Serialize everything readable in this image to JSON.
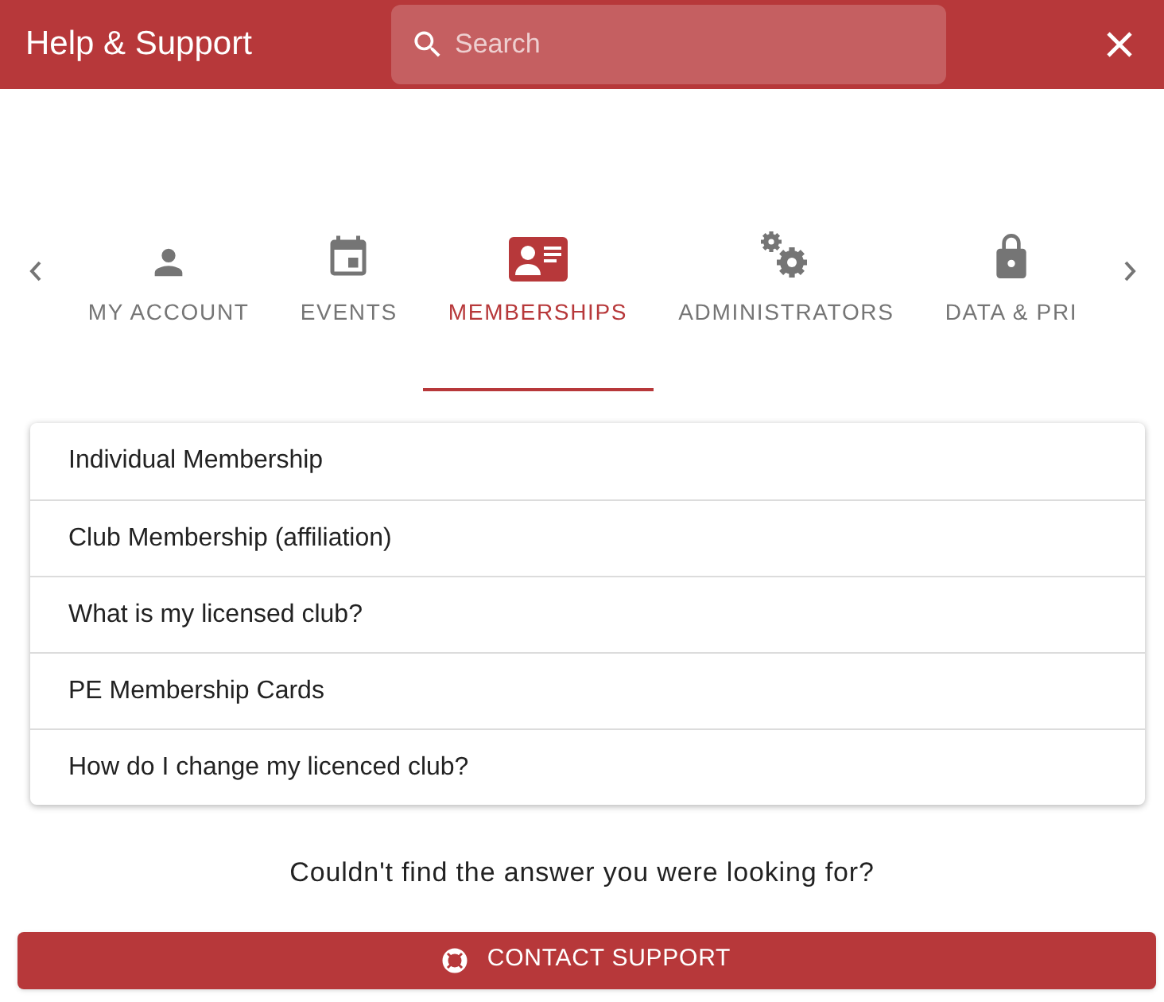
{
  "header": {
    "title": "Help & Support",
    "search": {
      "placeholder": "Search"
    }
  },
  "tabs": [
    {
      "label": "MY ACCOUNT",
      "kind": "person",
      "selected": false
    },
    {
      "label": "EVENTS",
      "kind": "calendar",
      "selected": false
    },
    {
      "label": "MEMBERSHIPS",
      "kind": "card",
      "selected": true
    },
    {
      "label": "ADMINISTRATORS",
      "kind": "gears",
      "selected": false
    },
    {
      "label": "DATA & PRI",
      "kind": "lock",
      "selected": false
    }
  ],
  "topics": [
    "Individual Membership",
    "Club Membership (affiliation)",
    "What is my licensed club?",
    "PE Membership Cards",
    "How do I change my licenced club?"
  ],
  "prompt": "Couldn't find the answer you were looking for?",
  "contact_button": "CONTACT SUPPORT"
}
